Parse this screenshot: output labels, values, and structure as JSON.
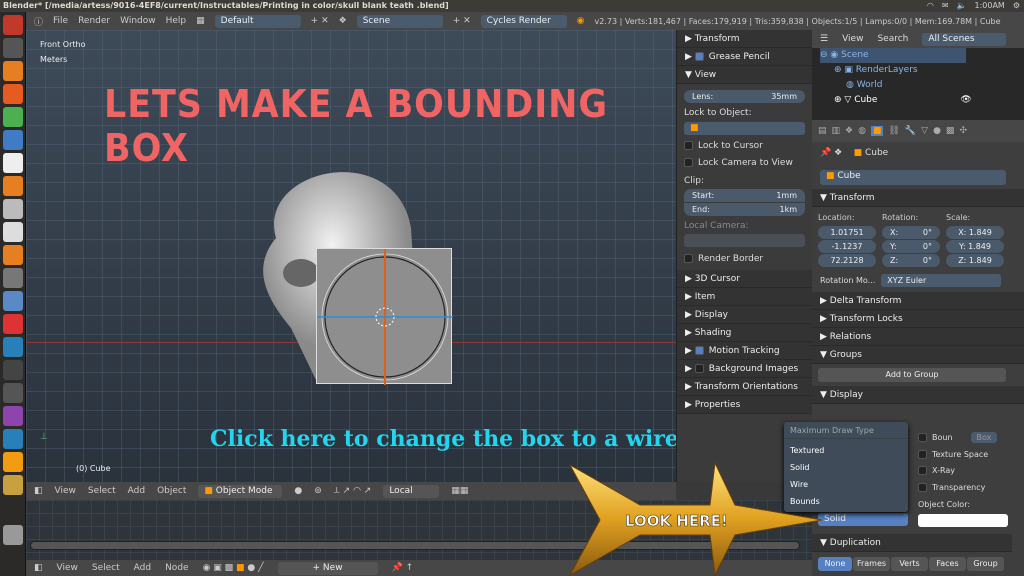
{
  "window": {
    "title": "Blender* [/media/artess/9016-4EF8/current/Instructables/Printing in color/skull blank teath .blend]",
    "clock": "1:00AM"
  },
  "header": {
    "menus": [
      "File",
      "Render",
      "Window",
      "Help"
    ],
    "layout": "Default",
    "scene": "Scene",
    "engine": "Cycles Render",
    "stats": "v2.73 | Verts:181,467 | Faces:179,919 | Tris:359,838 | Objects:1/5 | Lamps:0/0 | Mem:169.78M | Cube"
  },
  "viewport": {
    "view_name": "Front Ortho",
    "units": "Meters",
    "object_label": "(0) Cube",
    "overlay_title": "Lets make a bounding box",
    "overlay_hint": "Click here to change the box to a wire frame»»»",
    "arrow_text": "LOOK HERE!"
  },
  "npanel": {
    "transform": "Transform",
    "grease_pencil": "Grease Pencil",
    "view": "View",
    "lens_label": "Lens:",
    "lens_value": "35mm",
    "lock_to_object": "Lock to Object:",
    "lock_to_cursor": "Lock to Cursor",
    "lock_camera": "Lock Camera to View",
    "clip": "Clip:",
    "clip_start_label": "Start:",
    "clip_start": "1mm",
    "clip_end_label": "End:",
    "clip_end": "1km",
    "local_camera": "Local Camera:",
    "render_border": "Render Border",
    "sections": [
      "3D Cursor",
      "Item",
      "Display",
      "Shading",
      "Motion Tracking",
      "Background Images",
      "Transform Orientations",
      "Properties"
    ]
  },
  "view3d_header": {
    "menus": [
      "View",
      "Select",
      "Add",
      "Object"
    ],
    "mode": "Object Mode",
    "orientation": "Local"
  },
  "node_header": {
    "menus": [
      "View",
      "Select",
      "Add",
      "Node"
    ],
    "new": "New"
  },
  "outliner": {
    "menus": [
      "View",
      "Search"
    ],
    "filter": "All Scenes",
    "items": [
      "Scene",
      "RenderLayers",
      "World",
      "Cube"
    ]
  },
  "properties": {
    "breadcrumb": "Cube",
    "object_name": "Cube",
    "transform": "Transform",
    "location_label": "Location:",
    "rotation_label": "Rotation:",
    "scale_label": "Scale:",
    "location": [
      "1.01751",
      "-1.1237",
      "72.2128"
    ],
    "rotation": [
      [
        "X:",
        "0°"
      ],
      [
        "Y:",
        "0°"
      ],
      [
        "Z:",
        "0°"
      ]
    ],
    "scale": [
      "X: 1.849",
      "Y: 1.849",
      "Z: 1.849"
    ],
    "rotation_mode_label": "Rotation Mo...",
    "rotation_mode": "XYZ Euler",
    "delta_transform": "Delta Transform",
    "transform_locks": "Transform Locks",
    "relations": "Relations",
    "groups": "Groups",
    "add_to_group": "Add to Group",
    "display": "Display",
    "bounds": "Boun",
    "bounds_type": "Box",
    "texture_space": "Texture Space",
    "xray": "X-Ray",
    "transparency": "Transparency",
    "object_color": "Object Color:",
    "draw_type": "Solid",
    "duplication": "Duplication",
    "dup_options": [
      "None",
      "Frames",
      "Verts",
      "Faces",
      "Group"
    ]
  },
  "draw_type_menu": {
    "title": "Maximum Draw Type",
    "options": [
      "Textured",
      "Solid",
      "Wire",
      "Bounds"
    ]
  },
  "colors": {
    "overlay_title": "#f06464",
    "overlay_hint": "#22d6f0",
    "accent": "#5680c2",
    "arrow": "#e0a020"
  }
}
